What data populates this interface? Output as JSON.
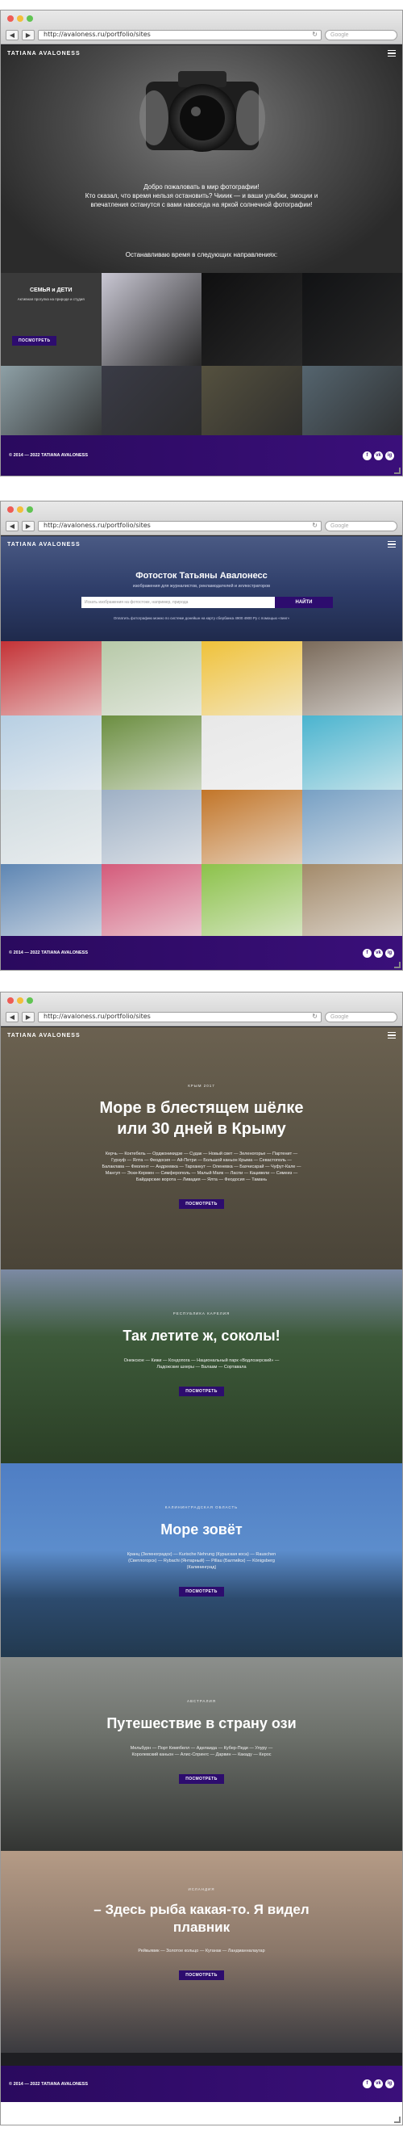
{
  "browser": {
    "url": "http://avaloness.ru/portfolio/sites",
    "search_placeholder": "Google",
    "back": "◀",
    "forward": "▶",
    "reload": "↻"
  },
  "site": {
    "brand": "TATIANA AVALONESS",
    "footer_copy": "© 2014 — 2022 TATIANA AVALONESS",
    "socials": [
      "f",
      "vk",
      "ig"
    ]
  },
  "page1": {
    "hero_text": "Добро пожаловать в мир фотографии!\nКто сказал, что время нельзя остановить? Чииик — и ваши улыбки, эмоции и впечатления останутся с вами навсегда на яркой солнечной фотографии!",
    "hero_sub": "Останавливаю время в следующих направлениях:",
    "feature": {
      "title": "СЕМЬЯ и ДЕТИ",
      "desc": "Активная прогулка на природе и студия",
      "button": "посмотреть"
    },
    "tiles": [
      "#c9c7d3",
      "#0f0f10",
      "#111214",
      "#8ea0a6",
      "#3a3b46",
      "#55513f",
      "#55656f",
      "#9b9da0"
    ]
  },
  "page2": {
    "title": "Фотосток Татьяны Авалонесс",
    "subtitle": "изображения для журналистов, рекламодателей и иллюстраторов",
    "search_placeholder": "Искать изображения на фотостоке, например, природа",
    "search_button": "НАЙТИ",
    "note": "Оплатить фотографию можно по системе донейшн на карту сбербанка 4900 4900 Ру с помощью «пинг»",
    "tiles": [
      "#c43236",
      "#b7c9a8",
      "#f0c23a",
      "#7a6a5a",
      "#b7cfe3",
      "#6b8e40",
      "#e8e8e8",
      "#4ab4cf",
      "#cfdbe0",
      "#9eb0c5",
      "#c27528",
      "#77a0c4",
      "#5e86b3",
      "#d45a7a",
      "#8cc24a",
      "#a38a6a"
    ]
  },
  "page3": {
    "sections": [
      {
        "kicker": "крым 2017",
        "title": "Море в блестящем шёлке или 30 дней в Крыму",
        "places": "Керчь — Коктебель — Орджоникидзе — Судак — Новый свет — Зеленогорье — Партенит — Гурзуф — Ялта — Феодосия — Ай-Петри — Большой каньон Крыма — Севастополь — Балаклава — Фиолент — Андреевка — Тарханкут — Оленевка — Бахчисарай — Чуфут-Кале — Мангуп — Эски-Кермен — Симферополь — Малый Маяк — Ласпи — Кацивели — Симеиз — Байдарские ворота — Ливадия — Ялта — Феодосия — Тамань",
        "button": "посмотреть"
      },
      {
        "kicker": "Республика Карелия",
        "title": "Так летите ж, соколы!",
        "places": "Онежское — Кижи — Кондопога — Национальный парк «Водлозерский» — Ладожские шхеры — Валаам — Сортавала",
        "button": "посмотреть"
      },
      {
        "kicker": "Калининградская область",
        "title": "Море зовёт",
        "places": "Кранц (Зеленоградск) — Kurische Nehrung (Куршская коса) — Rauschen (Светлогорск) — Rybachi (Янтарный) — Pillau (Балтийск) — Königsberg (Калининград)",
        "button": "посмотреть"
      },
      {
        "kicker": "Австралия",
        "title": "Путешествие в страну ози",
        "places": "Мельбурн — Порт Кемпбелл — Аделаида — Кубер-Педи — Улуру — Королевский каньон — Алис-Спрингс — Дарвин — Какаду — Керос",
        "button": "посмотреть"
      },
      {
        "kicker": "Исландия",
        "title": "– Здесь рыба какая-то. Я видел плавник",
        "places": "Рейкьявик — Золотое кольцо — Куганак — Ландманналаугар",
        "button": "посмотреть"
      }
    ]
  },
  "colors": {
    "accent": "#2d0c6e",
    "footer_from": "#2a0a5e",
    "footer_to": "#3a0f7a"
  }
}
